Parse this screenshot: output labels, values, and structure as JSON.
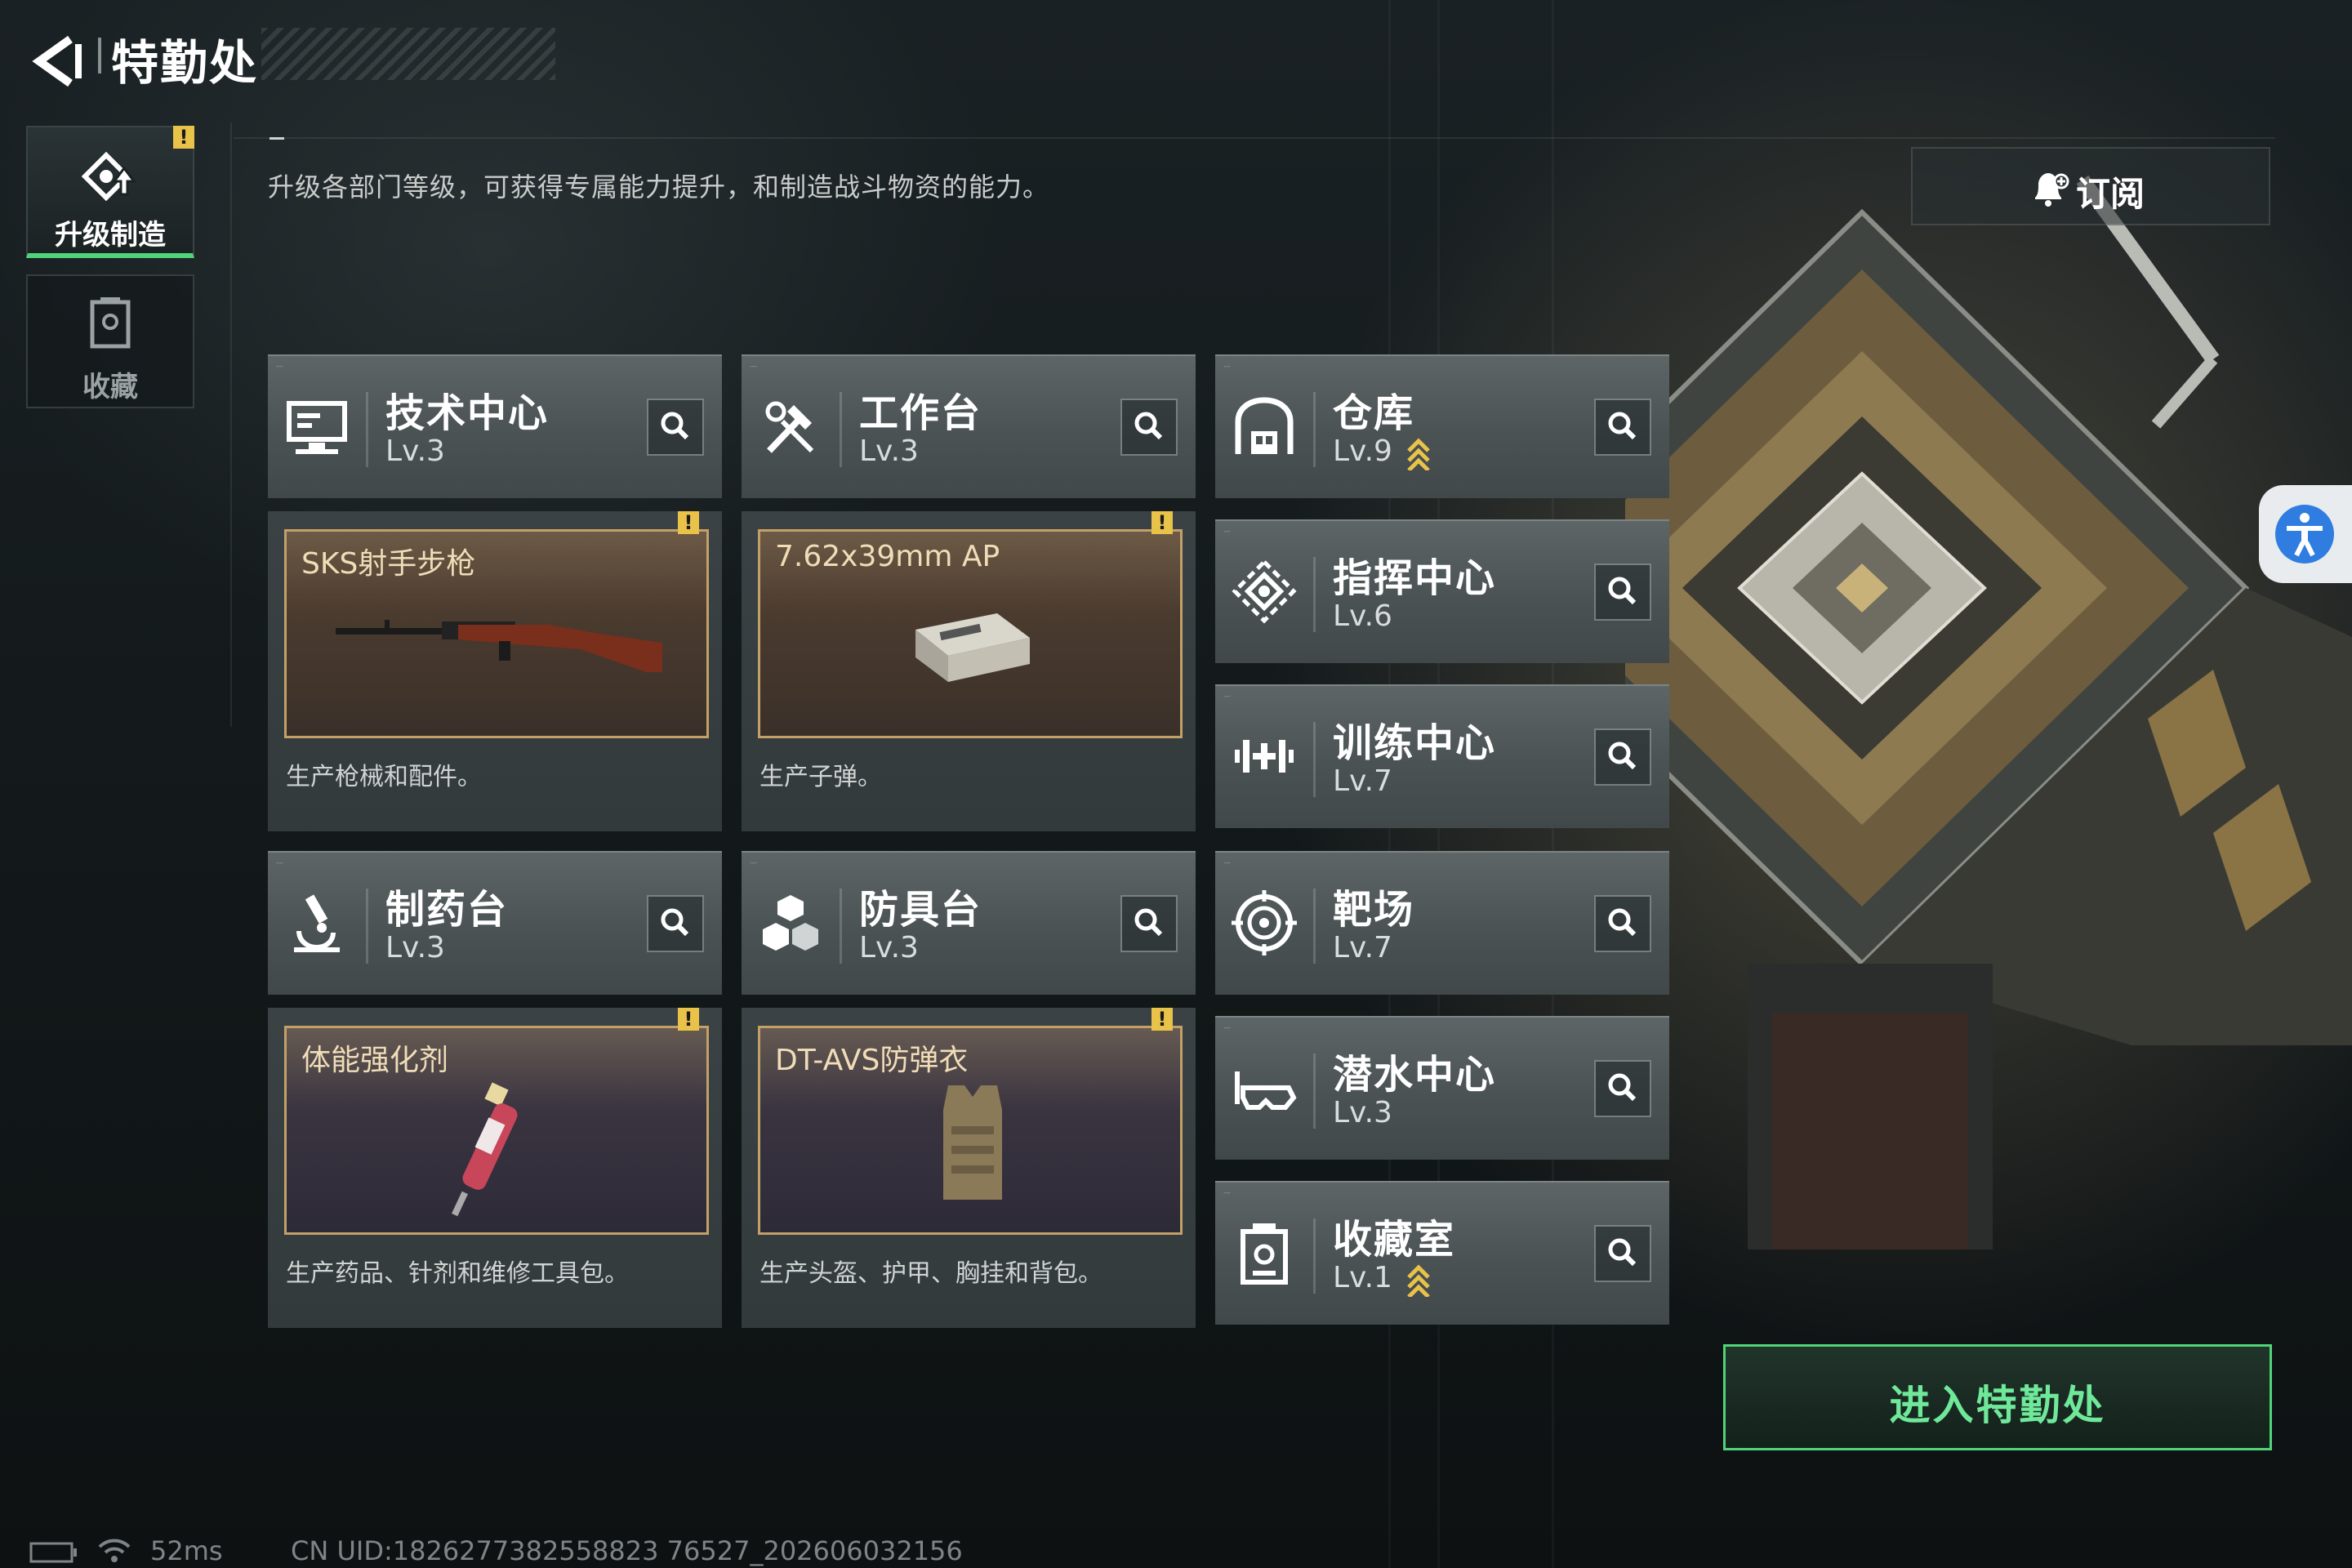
{
  "header": {
    "title": "特勤处"
  },
  "nav": {
    "items": [
      {
        "label": "升级制造",
        "active": true
      },
      {
        "label": "收藏",
        "active": false
      }
    ]
  },
  "description": "升级各部门等级，可获得专属能力提升，和制造战斗物资的能力。",
  "subscribe": {
    "label": "订阅"
  },
  "facilities": [
    {
      "name": "技术中心",
      "level": "Lv.3",
      "icon": "monitor-icon"
    },
    {
      "name": "工作台",
      "level": "Lv.3",
      "icon": "tools-icon"
    },
    {
      "name": "仓库",
      "level": "Lv.9",
      "icon": "warehouse-icon",
      "upgradable": true
    },
    {
      "name": "指挥中心",
      "level": "Lv.6",
      "icon": "command-icon"
    },
    {
      "name": "训练中心",
      "level": "Lv.7",
      "icon": "dumbbell-icon"
    },
    {
      "name": "制药台",
      "level": "Lv.3",
      "icon": "microscope-icon"
    },
    {
      "name": "防具台",
      "level": "Lv.3",
      "icon": "armor-blocks-icon"
    },
    {
      "name": "靶场",
      "level": "Lv.7",
      "icon": "target-icon"
    },
    {
      "name": "潜水中心",
      "level": "Lv.3",
      "icon": "diving-mask-icon"
    },
    {
      "name": "收藏室",
      "level": "Lv.1",
      "icon": "collection-icon",
      "upgradable": true
    }
  ],
  "products": [
    {
      "item": "SKS射手步枪",
      "description": "生产枪械和配件。",
      "frame": "brown"
    },
    {
      "item": "7.62x39mm AP",
      "description": "生产子弹。",
      "frame": "brown"
    },
    {
      "item": "体能强化剂",
      "description": "生产药品、针剂和维修工具包。",
      "frame": "purple"
    },
    {
      "item": "DT-AVS防弹衣",
      "description": "生产头盔、护甲、胸挂和背包。",
      "frame": "purple"
    }
  ],
  "enter_button": {
    "label": "进入特勤处"
  },
  "status_bar": {
    "ping": "52ms",
    "uid": "CN UID:1826277382558823 76527_202606032156"
  },
  "colors": {
    "accent_green": "#4fd47a",
    "warning_yellow": "#e9c24a",
    "frame_gold": "#c3a067"
  }
}
